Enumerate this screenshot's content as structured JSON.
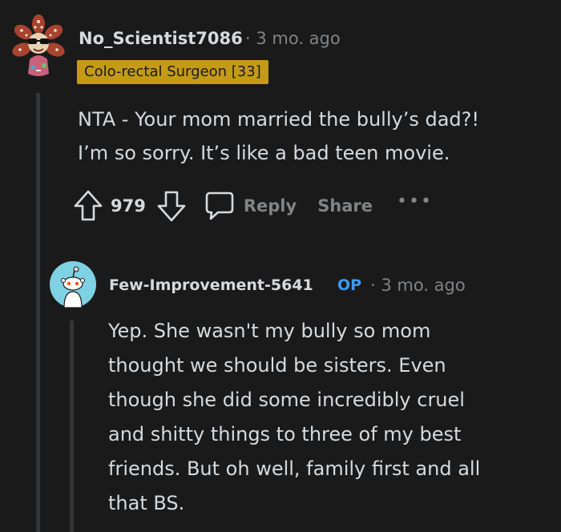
{
  "comments": [
    {
      "username": "No_Scientist7086",
      "meta": "· 3 mo. ago",
      "flair": "Colo-rectal Surgeon [33]",
      "avatar_icon": "flower-monster-icon",
      "body_lines": [
        "NTA - Your mom married the bully’s dad?!",
        "I’m so sorry. It’s like a bad teen movie."
      ],
      "actions": {
        "score": "979",
        "reply_label": "Reply",
        "share_label": "Share",
        "more_label": "•••"
      }
    },
    {
      "username": "Few-Improvement-5641",
      "op_badge": "OP",
      "meta": "· 3 mo. ago",
      "avatar_icon": "snoo-avatar-icon",
      "body_lines": [
        "Yep. She wasn't my bully so mom",
        "thought we should be sisters. Even",
        "though she did some incredibly cruel",
        "and shitty things to three of my best",
        "friends. But oh well, family first and all",
        "that BS."
      ]
    }
  ],
  "colors": {
    "background": "#1a1a1b",
    "text": "#d7dadc",
    "muted": "#818384",
    "flair_bg": "#c49a17",
    "op_blue": "#3a9bf0",
    "avatar2_bg": "#7fd1e4"
  }
}
